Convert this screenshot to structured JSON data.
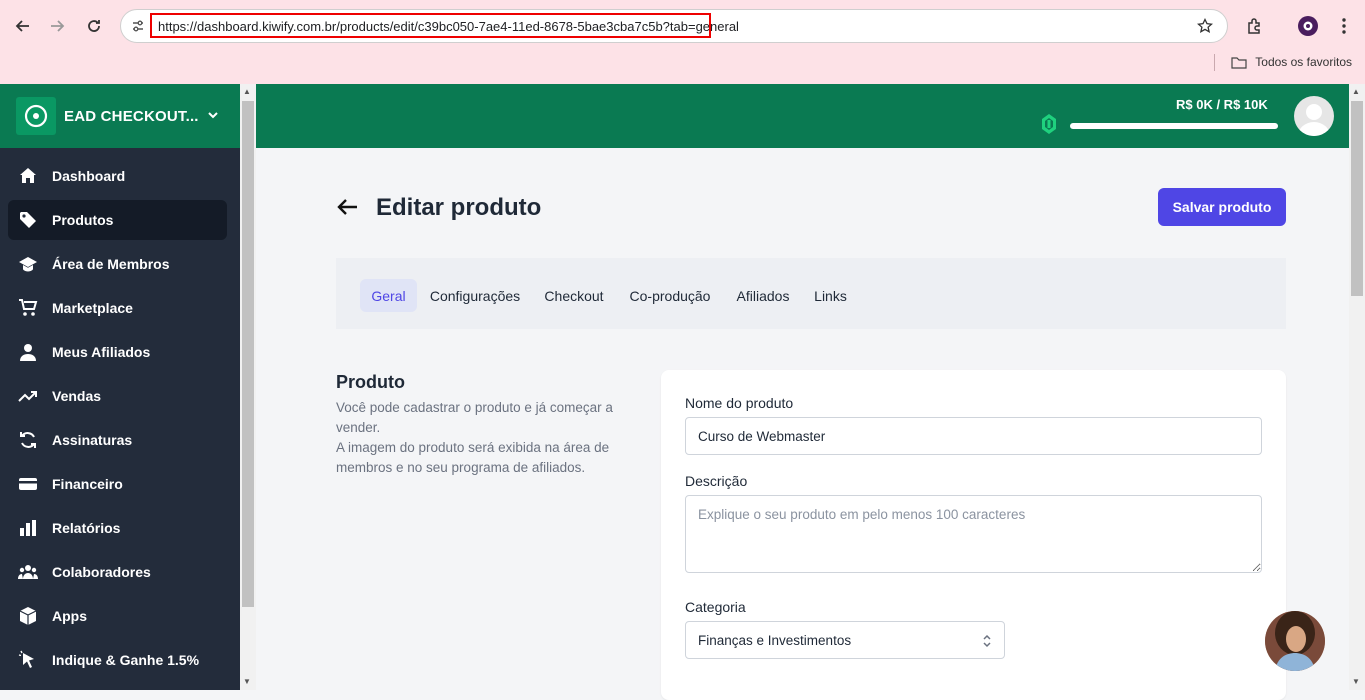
{
  "browser": {
    "url": "https://dashboard.kiwify.com.br/products/edit/c39bc050-7ae4-11ed-8678-5bae3cba7c5b?tab=general",
    "bookmarks_label": "Todos os favoritos"
  },
  "sidebar": {
    "org_name": "EAD CHECKOUT...",
    "items": [
      {
        "label": "Dashboard",
        "icon": "home-icon"
      },
      {
        "label": "Produtos",
        "icon": "tag-icon"
      },
      {
        "label": "Área de Membros",
        "icon": "graduation-cap-icon"
      },
      {
        "label": "Marketplace",
        "icon": "cart-icon"
      },
      {
        "label": "Meus Afiliados",
        "icon": "person-icon"
      },
      {
        "label": "Vendas",
        "icon": "trend-up-icon"
      },
      {
        "label": "Assinaturas",
        "icon": "sync-icon"
      },
      {
        "label": "Financeiro",
        "icon": "credit-card-icon"
      },
      {
        "label": "Relatórios",
        "icon": "bar-chart-icon"
      },
      {
        "label": "Colaboradores",
        "icon": "people-icon"
      },
      {
        "label": "Apps",
        "icon": "cube-icon"
      },
      {
        "label": "Indique & Ganhe 1.5%",
        "icon": "pointer-icon"
      }
    ],
    "active_index": 1
  },
  "header": {
    "goal_text": "R$ 0K / R$ 10K",
    "goal_progress": 0
  },
  "page": {
    "title": "Editar produto",
    "save_label": "Salvar produto",
    "tabs": [
      "Geral",
      "Configurações",
      "Checkout",
      "Co-produção",
      "Afiliados",
      "Links"
    ],
    "active_tab": 0
  },
  "section": {
    "title": "Produto",
    "desc1": "Você pode cadastrar o produto e já começar a vender.",
    "desc2": "A imagem do produto será exibida na área de membros e no seu programa de afiliados."
  },
  "form": {
    "name_label": "Nome do produto",
    "name_value": "Curso de Webmaster",
    "desc_label": "Descrição",
    "desc_placeholder": "Explique o seu produto em pelo menos 100 caracteres",
    "category_label": "Categoria",
    "category_value": "Finanças e Investimentos"
  },
  "colors": {
    "brand_green": "#0a7a52",
    "sidebar_bg": "#232c3b",
    "accent": "#4f46e5"
  }
}
